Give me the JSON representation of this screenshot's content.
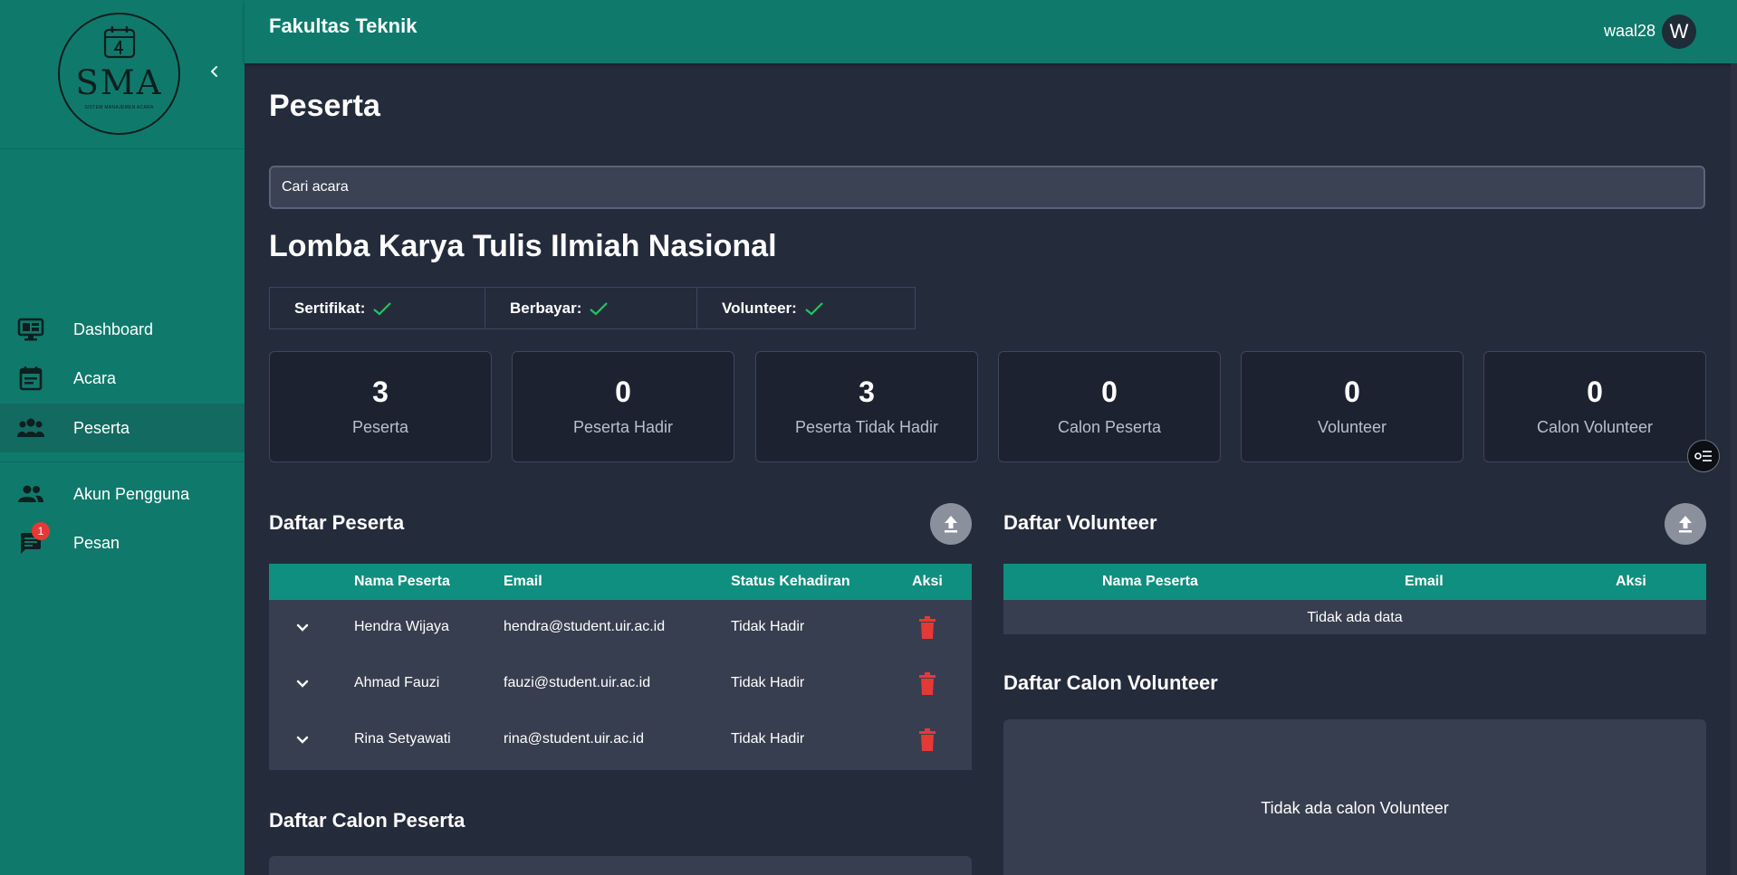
{
  "sidebar": {
    "logo_text": "SMA",
    "logo_subtext": "SISTEM MANAJEMEN ACARA",
    "items": [
      {
        "label": "Dashboard",
        "icon": "monitor-dashboard-icon"
      },
      {
        "label": "Acara",
        "icon": "calendar-icon"
      },
      {
        "label": "Peserta",
        "icon": "people-group-icon",
        "active": true
      },
      {
        "label": "Akun Pengguna",
        "icon": "users-icon"
      },
      {
        "label": "Pesan",
        "icon": "chat-icon",
        "badge": "1"
      }
    ]
  },
  "header": {
    "org": "Fakultas Teknik",
    "username": "waal28",
    "avatar_letter": "W"
  },
  "page": {
    "title": "Peserta",
    "search_placeholder": "Cari acara",
    "event_title": "Lomba Karya Tulis Ilmiah Nasional"
  },
  "flags": [
    {
      "label": "Sertifikat:",
      "checked": true
    },
    {
      "label": "Berbayar:",
      "checked": true
    },
    {
      "label": "Volunteer:",
      "checked": true
    }
  ],
  "stats": [
    {
      "value": "3",
      "label": "Peserta"
    },
    {
      "value": "0",
      "label": "Peserta Hadir"
    },
    {
      "value": "3",
      "label": "Peserta Tidak Hadir"
    },
    {
      "value": "0",
      "label": "Calon Peserta"
    },
    {
      "value": "0",
      "label": "Volunteer"
    },
    {
      "value": "0",
      "label": "Calon Volunteer"
    }
  ],
  "peserta_table": {
    "title": "Daftar Peserta",
    "columns": [
      "Nama Peserta",
      "Email",
      "Status Kehadiran",
      "Aksi"
    ],
    "rows": [
      {
        "name": "Hendra Wijaya",
        "email": "hendra@student.uir.ac.id",
        "status": "Tidak Hadir"
      },
      {
        "name": "Ahmad Fauzi",
        "email": "fauzi@student.uir.ac.id",
        "status": "Tidak Hadir"
      },
      {
        "name": "Rina Setyawati",
        "email": "rina@student.uir.ac.id",
        "status": "Tidak Hadir"
      }
    ]
  },
  "volunteer_table": {
    "title": "Daftar Volunteer",
    "columns": [
      "Nama Peserta",
      "Email",
      "Aksi"
    ],
    "empty": "Tidak ada data"
  },
  "calon_volunteer": {
    "title": "Daftar Calon Volunteer",
    "empty": "Tidak ada calon Volunteer"
  },
  "calon_peserta": {
    "title": "Daftar Calon Peserta"
  },
  "colors": {
    "sidebar": "#0f7a6c",
    "table_header": "#0f8f7f",
    "background": "#242b3b",
    "check": "#22c55e",
    "trash": "#e53935"
  }
}
